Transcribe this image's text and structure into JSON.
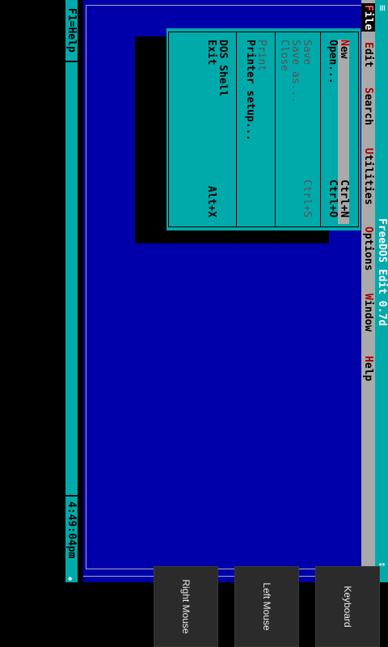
{
  "window": {
    "title": "FreeDOS Edit 0.7d",
    "system_menu": "≡",
    "size_button": "↕"
  },
  "menubar": {
    "file": {
      "hotkey": "F",
      "rest": "ile"
    },
    "edit": {
      "hotkey": "E",
      "rest": "dit"
    },
    "search": {
      "hotkey": "S",
      "rest": "earch"
    },
    "utilities": {
      "hotkey": "U",
      "rest": "tilities"
    },
    "options": {
      "hotkey": "O",
      "rest": "ptions"
    },
    "window": {
      "hotkey": "W",
      "rest": "indow"
    },
    "help": {
      "hotkey": "H",
      "rest": "elp"
    }
  },
  "file_menu": {
    "new": {
      "hotkey": "N",
      "rest": "ew",
      "accel": "Ctrl+N"
    },
    "open": {
      "label": "Open...",
      "accel": "Ctrl+O"
    },
    "save": {
      "label": "Save",
      "accel": "Ctrl+S"
    },
    "save_as": {
      "label": "Save as..."
    },
    "close": {
      "label": "Close"
    },
    "print": {
      "label": "Print"
    },
    "printer_setup": {
      "label": "Printer setup..."
    },
    "dos_shell": {
      "label": "DOS Shell"
    },
    "exit": {
      "label": "Exit",
      "accel": "Alt+X"
    }
  },
  "statusbar": {
    "help_hint": "F1=Help",
    "clock": "4:49:04pm"
  },
  "softkeys": {
    "keyboard": "Keyboard",
    "left_mouse": "Left Mouse",
    "right_mouse": "Right Mouse"
  },
  "colors": {
    "desktop": "#0000aa",
    "bar": "#00aaaa",
    "menubar": "#aaaaaa",
    "hotkey": "#aa0000"
  }
}
